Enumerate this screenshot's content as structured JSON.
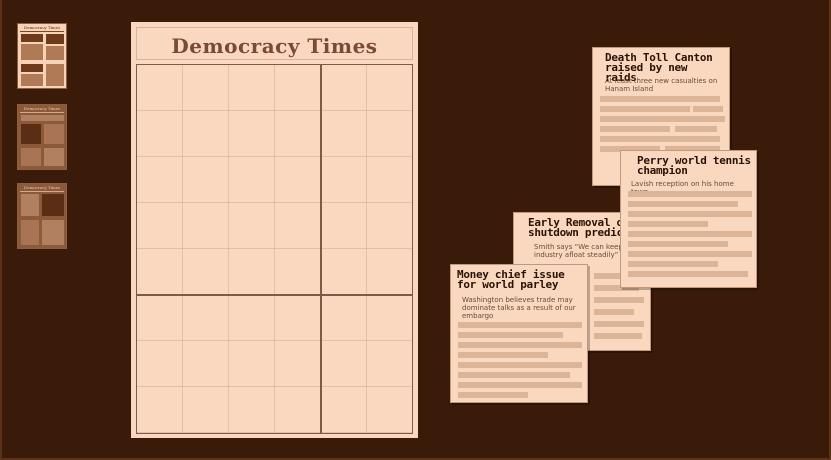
{
  "newspaper": {
    "masthead": "Democracy Times",
    "layout": {
      "columns": 2,
      "rows": 2
    }
  },
  "thumbnails": [
    {
      "title": "Democracy Times",
      "state": "current"
    },
    {
      "title": "Democracy Times",
      "state": "previous"
    },
    {
      "title": "Democracy Times",
      "state": "previous"
    }
  ],
  "stories": [
    {
      "headline": "Death Toll Canton raised by new raids",
      "subtitle": "At least three new casualties on Hanam Island"
    },
    {
      "headline": "Perry world tennis champion",
      "subtitle": "Lavish reception on his home town"
    },
    {
      "headline": "Early Removal of shutdown predicted",
      "subtitle": "Smith says “We can keep our industry afloat steadily”"
    },
    {
      "headline": "Money chief issue for world parley",
      "subtitle": "Washington believes trade may dominate talks as a result of our embargo"
    }
  ],
  "colors": {
    "background": "#3a1b09",
    "paper": "#fad8c0",
    "ink": "#2a1206",
    "masthead_ink": "#7a4a32",
    "filler_text": "#dcb497"
  }
}
